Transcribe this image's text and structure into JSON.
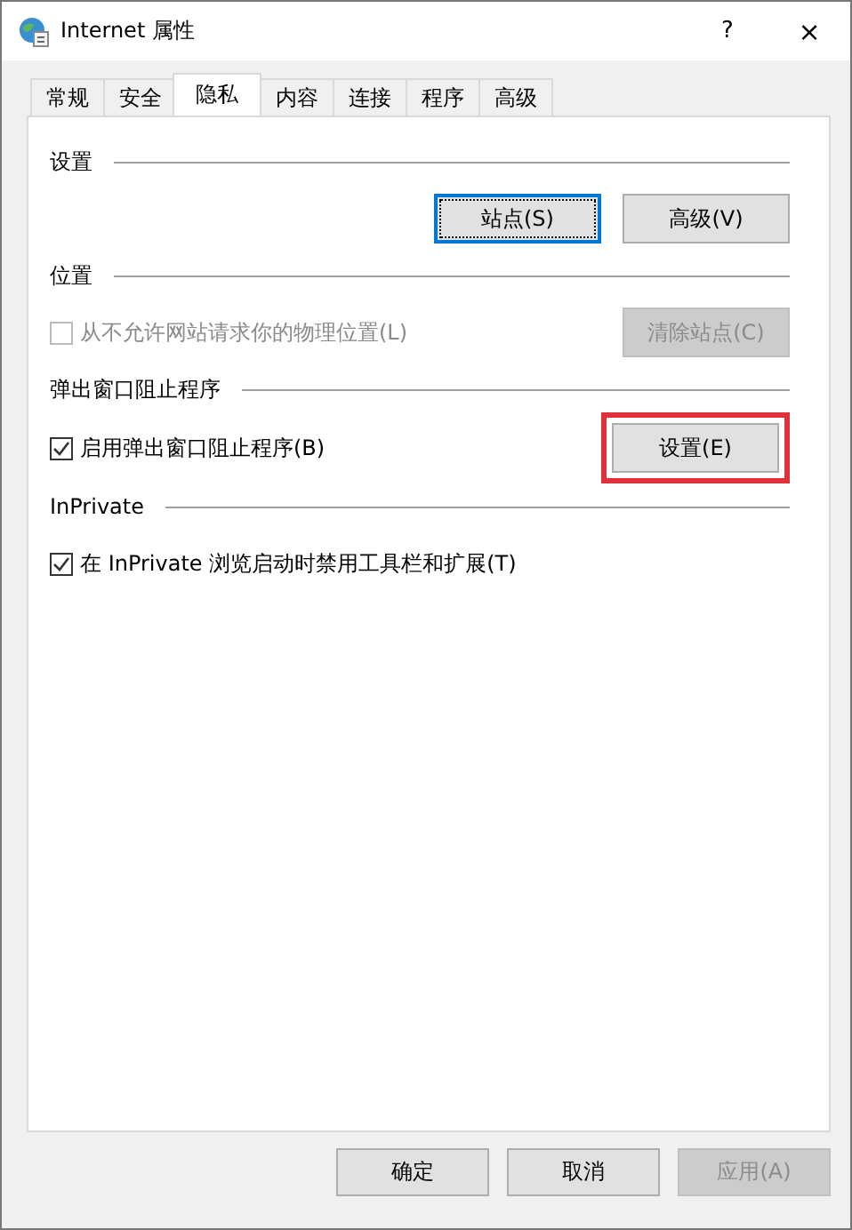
{
  "window": {
    "title": "Internet 属性",
    "help": "?",
    "close": "×"
  },
  "tabs": [
    {
      "label": "常规",
      "selected": false
    },
    {
      "label": "安全",
      "selected": false
    },
    {
      "label": "隐私",
      "selected": true
    },
    {
      "label": "内容",
      "selected": false
    },
    {
      "label": "连接",
      "selected": false
    },
    {
      "label": "程序",
      "selected": false
    },
    {
      "label": "高级",
      "selected": false
    }
  ],
  "sections": [
    {
      "title": "设置",
      "controls": [
        {
          "kind": "button",
          "label": "站点(S)",
          "focused": true,
          "disabled": false,
          "highlighted": false
        },
        {
          "kind": "button",
          "label": "高级(V)",
          "focused": false,
          "disabled": false,
          "highlighted": false
        }
      ]
    },
    {
      "title": "位置",
      "controls": [
        {
          "kind": "checkbox",
          "label": "从不允许网站请求你的物理位置(L)",
          "checked": false,
          "disabled": true
        },
        {
          "kind": "button",
          "label": "清除站点(C)",
          "focused": false,
          "disabled": true,
          "highlighted": false
        }
      ]
    },
    {
      "title": "弹出窗口阻止程序",
      "controls": [
        {
          "kind": "checkbox",
          "label": "启用弹出窗口阻止程序(B)",
          "checked": true,
          "disabled": false
        },
        {
          "kind": "button",
          "label": "设置(E)",
          "focused": false,
          "disabled": false,
          "highlighted": true
        }
      ]
    },
    {
      "title": "InPrivate",
      "controls": [
        {
          "kind": "checkbox",
          "label": "在 InPrivate 浏览启动时禁用工具栏和扩展(T)",
          "checked": true,
          "disabled": false
        }
      ]
    }
  ],
  "footer": [
    {
      "label": "确定",
      "disabled": false
    },
    {
      "label": "取消",
      "disabled": false
    },
    {
      "label": "应用(A)",
      "disabled": true
    }
  ]
}
